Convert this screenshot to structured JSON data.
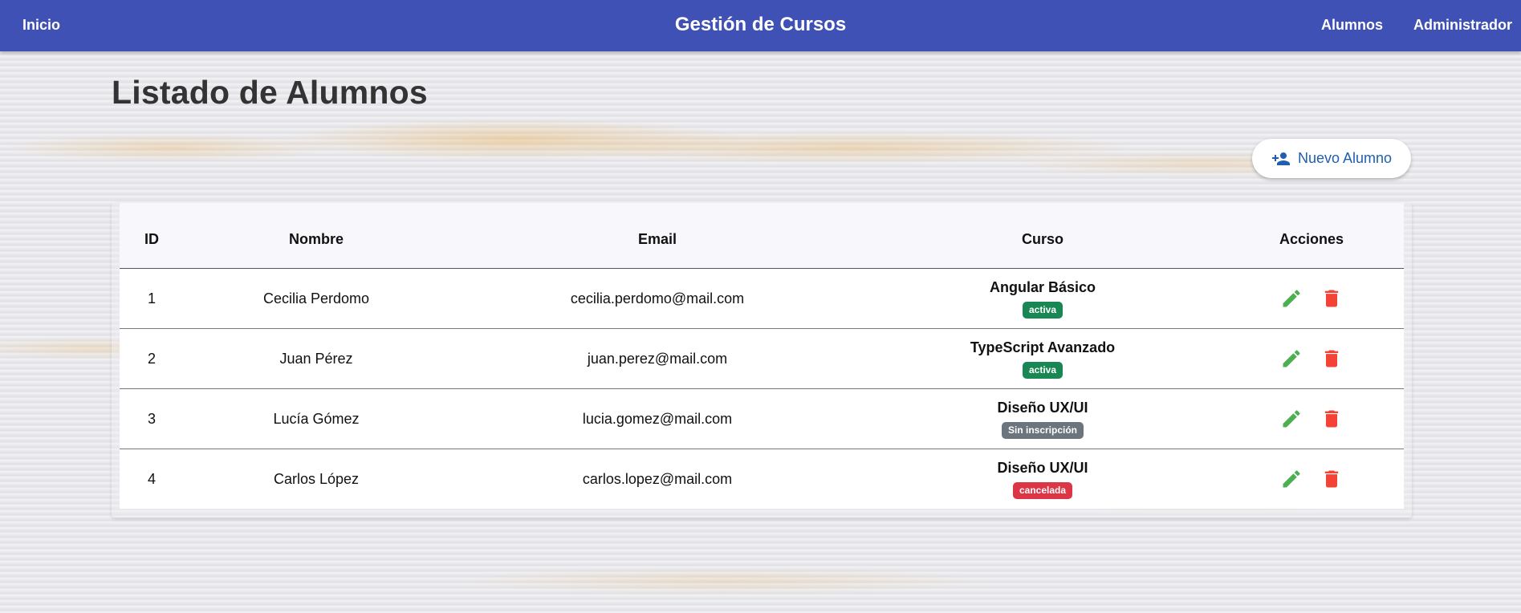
{
  "navbar": {
    "home_label": "Inicio",
    "title": "Gestión de Cursos",
    "students_label": "Alumnos",
    "admin_label": "Administrador"
  },
  "page": {
    "title": "Listado de Alumnos",
    "new_button_label": "Nuevo Alumno",
    "new_button_icon": "person-add-icon"
  },
  "table": {
    "headers": [
      "ID",
      "Nombre",
      "Email",
      "Curso",
      "Acciones"
    ],
    "rows": [
      {
        "id": "1",
        "name": "Cecilia Perdomo",
        "email": "cecilia.perdomo@mail.com",
        "course": "Angular Básico",
        "status": "activa"
      },
      {
        "id": "2",
        "name": "Juan Pérez",
        "email": "juan.perez@mail.com",
        "course": "TypeScript Avanzado",
        "status": "activa"
      },
      {
        "id": "3",
        "name": "Lucía Gómez",
        "email": "lucia.gomez@mail.com",
        "course": "Diseño UX/UI",
        "status": "Sin inscripción"
      },
      {
        "id": "4",
        "name": "Carlos López",
        "email": "carlos.lopez@mail.com",
        "course": "Diseño UX/UI",
        "status": "cancelada"
      }
    ],
    "action_icons": [
      "edit-icon",
      "delete-icon"
    ]
  },
  "colors": {
    "navbar": "#3f51b5",
    "status_active": "#198754",
    "status_none": "#6c757d",
    "status_cancelled": "#dc3545",
    "edit_icon": "#4caf50",
    "delete_icon": "#f44336",
    "button_text": "#1e5fae"
  }
}
